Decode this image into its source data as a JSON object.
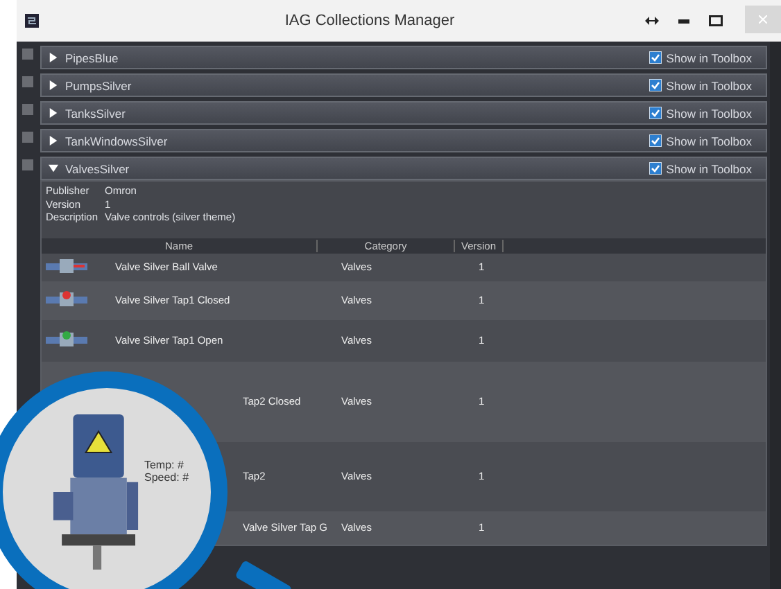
{
  "window": {
    "title": "IAG Collections Manager"
  },
  "collections": [
    {
      "name": "PipesBlue",
      "expanded": false,
      "show_in_toolbox": true,
      "toolbox_label": "Show in Toolbox"
    },
    {
      "name": "PumpsSilver",
      "expanded": false,
      "show_in_toolbox": true,
      "toolbox_label": "Show in Toolbox"
    },
    {
      "name": "TanksSilver",
      "expanded": false,
      "show_in_toolbox": true,
      "toolbox_label": "Show in Toolbox"
    },
    {
      "name": "TankWindowsSilver",
      "expanded": false,
      "show_in_toolbox": true,
      "toolbox_label": "Show in Toolbox"
    },
    {
      "name": "ValvesSilver",
      "expanded": true,
      "show_in_toolbox": true,
      "toolbox_label": "Show in Toolbox",
      "details": {
        "fields": [
          {
            "label": "Publisher",
            "value": "Omron"
          },
          {
            "label": "Version",
            "value": "1"
          },
          {
            "label": "Description",
            "value": "Valve controls (silver theme)"
          }
        ],
        "columns": [
          "Name",
          "Category",
          "Version"
        ],
        "rows": [
          {
            "name": "Valve Silver Ball Valve",
            "category": "Valves",
            "version": "1"
          },
          {
            "name": "Valve Silver Tap1 Closed",
            "category": "Valves",
            "version": "1"
          },
          {
            "name": "Valve Silver Tap1 Open",
            "category": "Valves",
            "version": "1"
          },
          {
            "name": "Tap2 Closed",
            "category": "Valves",
            "version": "1"
          },
          {
            "name": "Tap2",
            "category": "Valves",
            "version": "1"
          },
          {
            "name": "Valve Silver Tap G",
            "category": "Valves",
            "version": "1"
          }
        ]
      }
    }
  ],
  "magnifier": {
    "lines": [
      "Temp: #",
      "Speed: #"
    ]
  }
}
